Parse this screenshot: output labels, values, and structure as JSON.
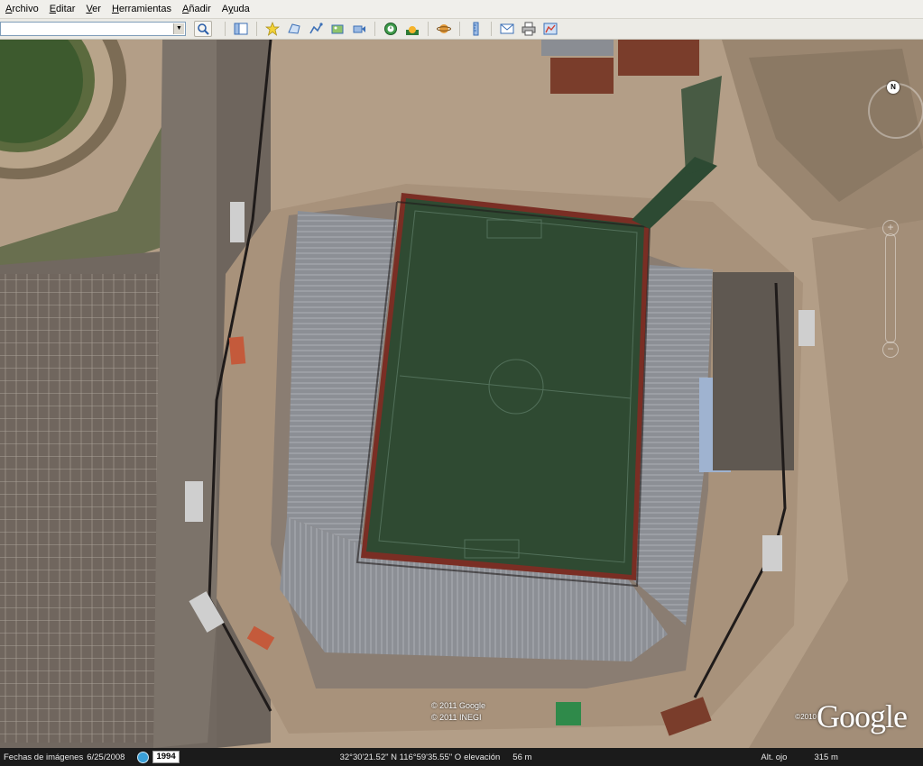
{
  "menubar": {
    "items": [
      {
        "label": "Archivo",
        "mnemonic": "A",
        "rest": "rchivo"
      },
      {
        "label": "Editar",
        "mnemonic": "E",
        "rest": "ditar"
      },
      {
        "label": "Ver",
        "mnemonic": "V",
        "rest": "er"
      },
      {
        "label": "Herramientas",
        "mnemonic": "H",
        "rest": "erramientas"
      },
      {
        "label": "Añadir",
        "mnemonic": "A",
        "rest": "ñadir"
      },
      {
        "label": "Ayuda",
        "mnemonic": "y",
        "pre": "A",
        "rest": "uda"
      }
    ]
  },
  "toolbar": {
    "search_value": "",
    "icons": [
      "search-icon",
      "sidebar-toggle-icon",
      "placemark-icon",
      "polygon-icon",
      "path-icon",
      "image-overlay-icon",
      "record-tour-icon",
      "historical-imagery-icon",
      "sunlight-icon",
      "planets-icon",
      "ruler-icon",
      "email-icon",
      "print-icon",
      "view-in-maps-icon"
    ]
  },
  "map": {
    "credit_line1": "© 2011 Google",
    "credit_line2": "© 2011 INEGI",
    "logo_text": "Google",
    "logo_year": "©2010",
    "north_label": "N"
  },
  "statusbar": {
    "imagery_date_label": "Fechas de imágenes",
    "imagery_date": "6/25/2008",
    "history_year": "1994",
    "coordinates": "32°30'21.52\" N 116°59'35.55\" O",
    "elevation_label": "elevación",
    "elevation_value": "56 m",
    "eye_alt_label": "Alt. ojo",
    "eye_alt_value": "315 m"
  },
  "colors": {
    "field": "#2f4a32",
    "stands": "#8a8d93",
    "dirt": "#b29c85",
    "statusbar": "#1b1b1b"
  }
}
